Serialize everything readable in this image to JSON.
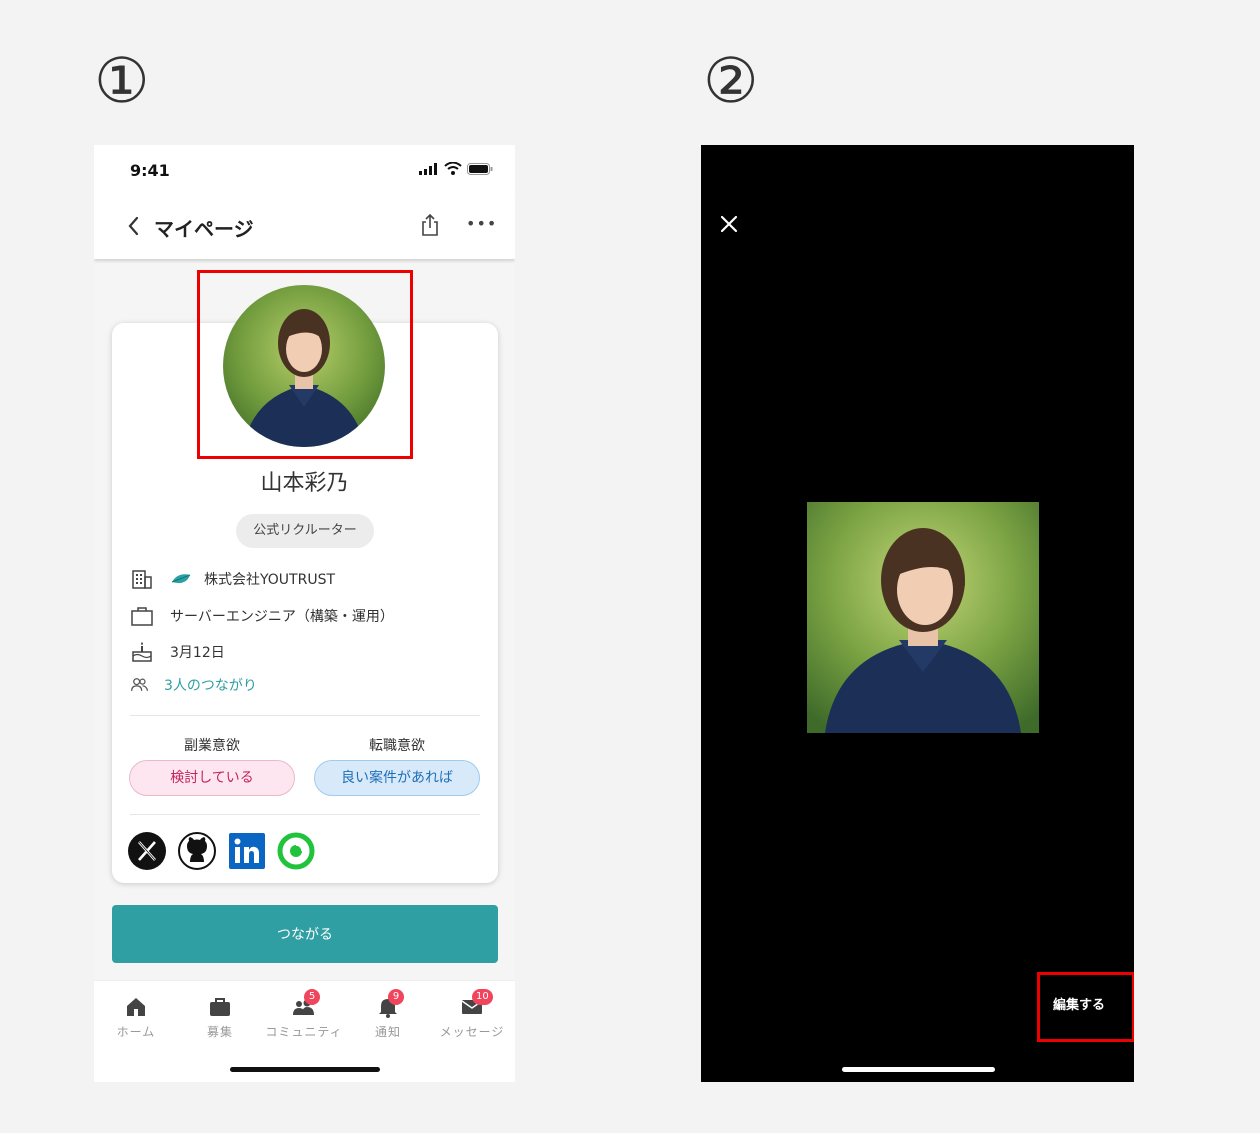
{
  "steps": {
    "first": "①",
    "second": "②"
  },
  "screen1": {
    "status_time": "9:41",
    "nav_title": "マイページ",
    "nav_more": "•••",
    "profile_name": "山本彩乃",
    "role_badge": "公式リクルーター",
    "company": "株式会社YOUTRUST",
    "position": "サーバーエンジニア（構築・運用）",
    "birthday": "3月12日",
    "connections": "3人のつながり",
    "side_job_label": "副業意欲",
    "side_job_value": "検討している",
    "job_change_label": "転職意欲",
    "job_change_value": "良い案件があれば",
    "connect_button": "つながる",
    "social_icons": [
      "x-icon",
      "github-icon",
      "linkedin-icon",
      "wantedly-icon"
    ],
    "tabs": [
      {
        "label": "ホーム",
        "icon": "home-icon",
        "badge": ""
      },
      {
        "label": "募集",
        "icon": "briefcase-icon",
        "badge": ""
      },
      {
        "label": "コミュニティ",
        "icon": "community-icon",
        "badge": "5"
      },
      {
        "label": "通知",
        "icon": "bell-icon",
        "badge": "9"
      },
      {
        "label": "メッセージ",
        "icon": "envelope-icon",
        "badge": "10"
      }
    ],
    "colors": {
      "accent": "#2f9fa3",
      "badge": "#f0455d",
      "highlight": "#e00000"
    }
  },
  "screen2": {
    "edit_label": "編集する"
  }
}
